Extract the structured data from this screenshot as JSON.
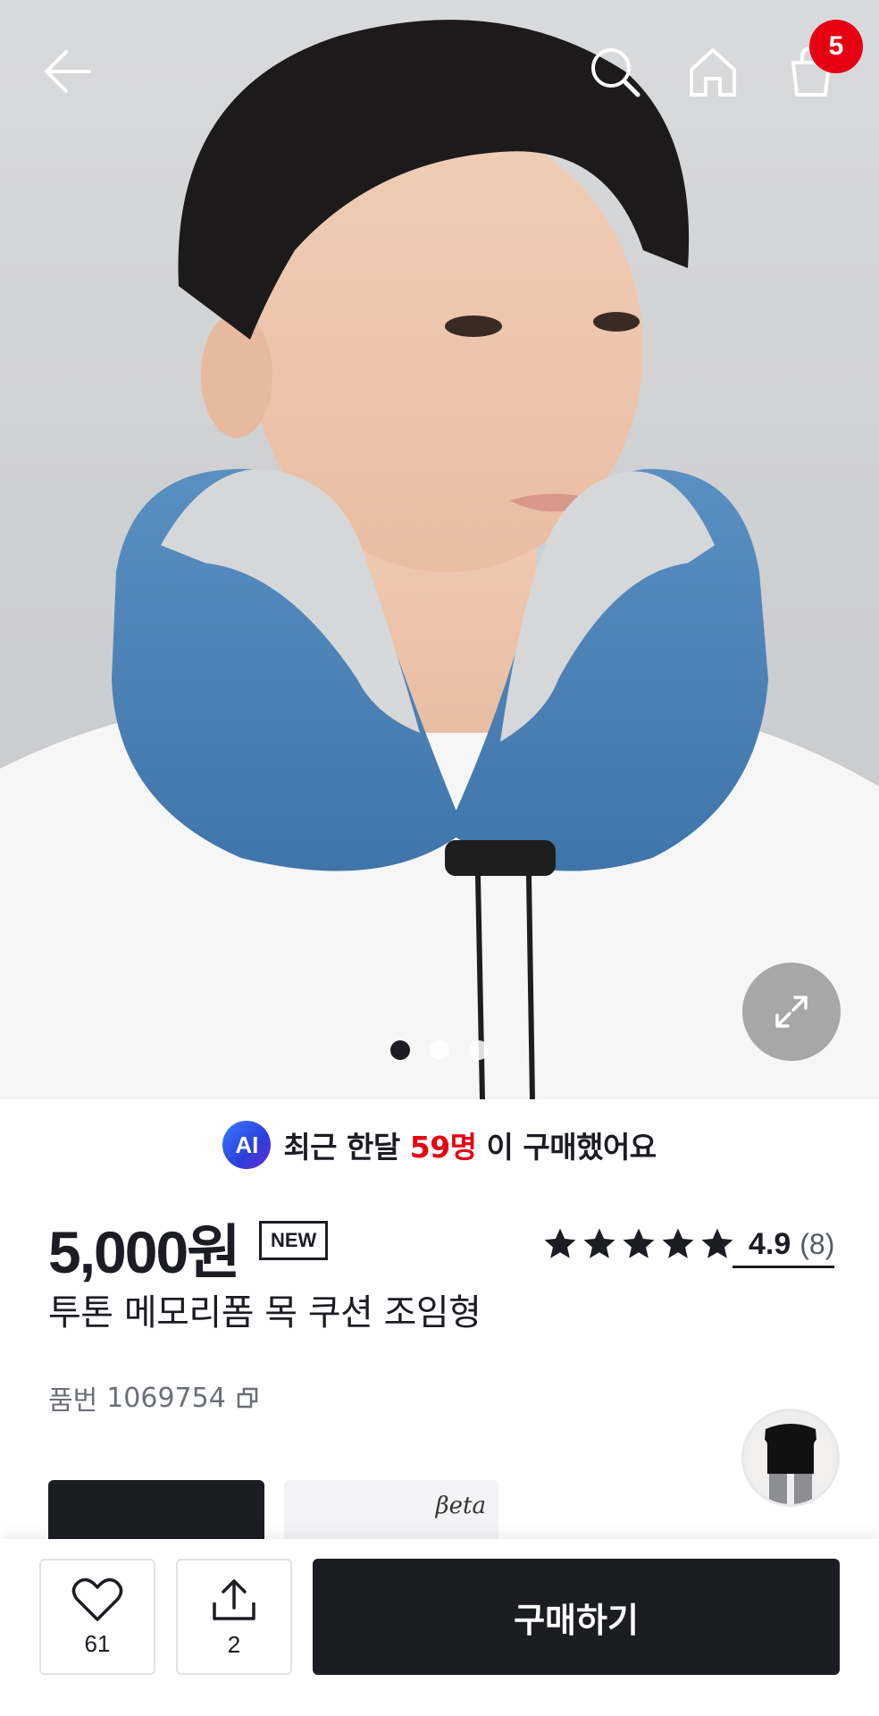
{
  "header": {
    "back_icon": "arrow-left-icon",
    "search_icon": "search-icon",
    "home_icon": "home-icon",
    "cart_icon": "shopping-bag-icon",
    "cart_count": "5"
  },
  "gallery": {
    "image_count": 3,
    "active_index": 0,
    "expand_icon": "expand-icon"
  },
  "ai_banner": {
    "badge": "AI",
    "text_before": "최근 한달 ",
    "highlight": "59명",
    "text_after": " 이 구매했어요",
    "highlight_color": "#e60012"
  },
  "product": {
    "price": "5,000원",
    "badge": "NEW",
    "rating": "4.9",
    "review_count": "(8)",
    "stars": 5,
    "title": "투톤 메모리폼 목 쿠션 조임형",
    "sku_label": "품번",
    "sku": "1069754"
  },
  "cards": {
    "beta_label": "βeta"
  },
  "actions": {
    "like_count": "61",
    "share_count": "2",
    "buy_label": "구매하기"
  },
  "colors": {
    "primary": "#1b1d23",
    "badge_red": "#e60012"
  }
}
